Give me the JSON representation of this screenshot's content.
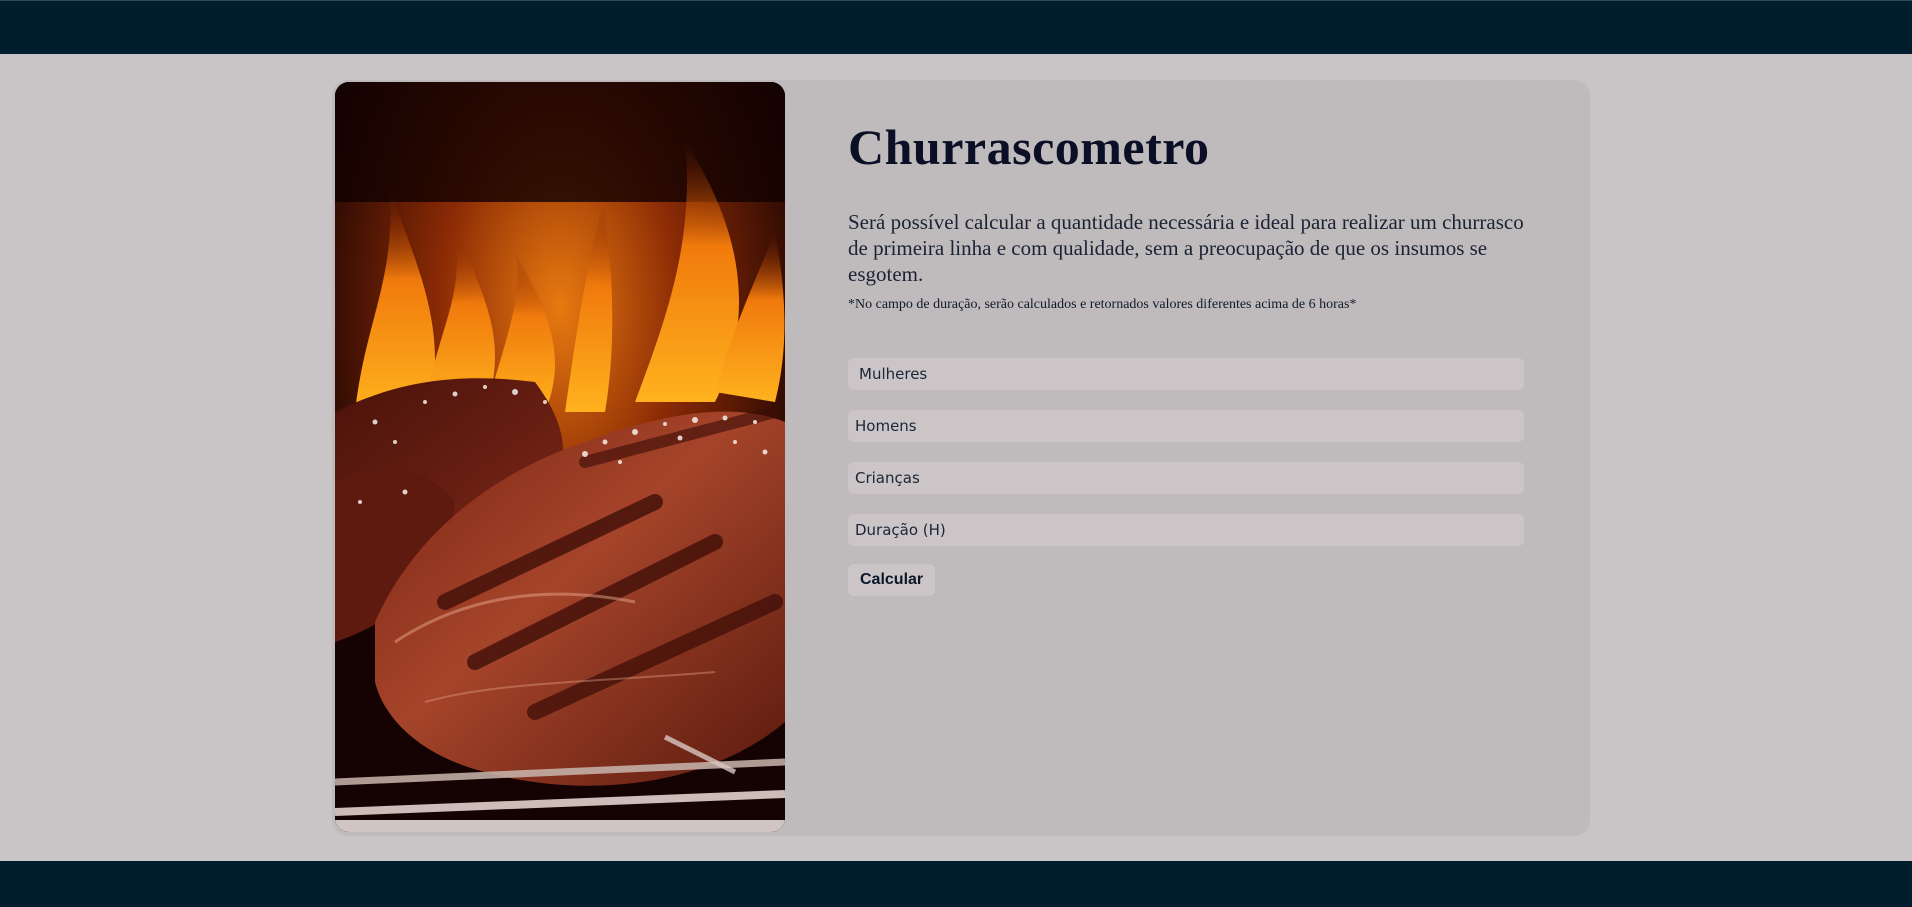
{
  "page": {
    "title": "Churrascometro",
    "description": "Será possível calcular a quantidade necessária e ideal para realizar um churrasco de primeira linha e com qualidade, sem a preocupação de que os insumos se esgotem.",
    "note": "*No campo de duração, serão calculados e retornados valores diferentes acima de 6 horas*"
  },
  "form": {
    "women_placeholder": "Mulheres",
    "men_placeholder": "Homens",
    "children_placeholder": "Crianças",
    "duration_placeholder": "Duração (H)",
    "calculate_label": "Calcular"
  },
  "colors": {
    "header_footer": "#001e2e",
    "page_background": "#c9c4c6",
    "card_background": "#bfbbbc",
    "input_background": "#cbc5c8"
  },
  "image": {
    "icon": "grilled-steak-photo"
  }
}
